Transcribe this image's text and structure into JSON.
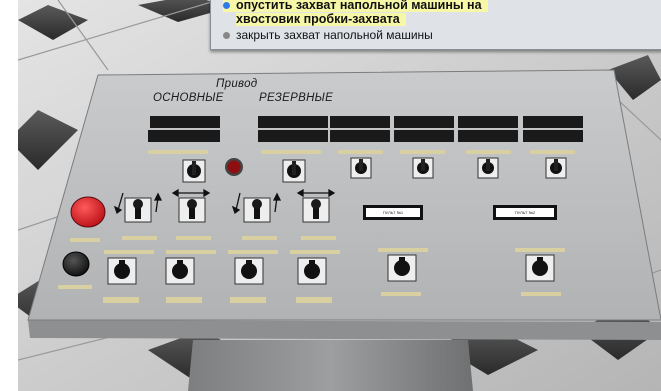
{
  "task": {
    "current_line1": "опустить захват напольной машины на",
    "current_line2": "хвостовик пробки-захвата",
    "next_item": "закрыть захват напольной машины"
  },
  "console": {
    "header_title": "Привод",
    "main_label": "ОСНОВНЫЕ",
    "reserve_label": "РЕЗЕРВНЫЕ",
    "panel1_label": "ПУЛЬТ №1",
    "panel2_label": "ПУЛЬТ №2"
  },
  "colors": {
    "console_face": "#b9bbbd",
    "stop_button": "#c8141c",
    "indicator_lamp": "#8e0f12",
    "task_highlight": "#f7f7a8"
  }
}
